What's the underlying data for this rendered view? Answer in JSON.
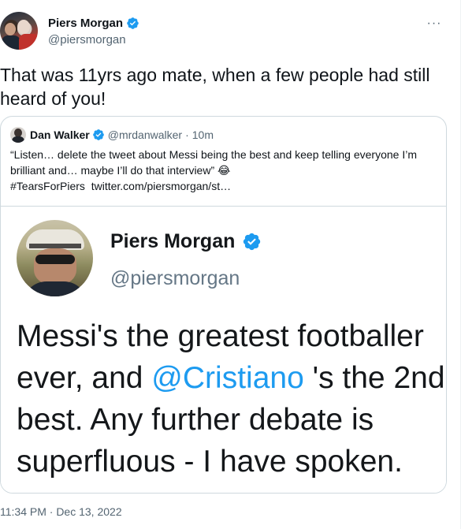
{
  "tweet": {
    "author_name": "Piers Morgan",
    "author_handle": "@piersmorgan",
    "more_label": "···",
    "text": "That was 11yrs ago mate, when a few people had still heard of you!",
    "timestamp": "11:34 PM · Dec 13, 2022"
  },
  "quote": {
    "author_name": "Dan Walker",
    "author_handle": "@mrdanwalker",
    "separator": "·",
    "time": "10m",
    "text": "“Listen… delete the tweet about Messi being the best and keep telling everyone I’m brilliant and… maybe I’ll do that interview” 😂",
    "hashtag": "#TearsForPiers",
    "link": "twitter.com/piersmorgan/st…"
  },
  "media": {
    "author_name": "Piers Morgan",
    "author_handle": "@piersmorgan",
    "text_part1": "Messi's the greatest footballer ever, and ",
    "mention": "@Cristiano",
    "text_part2": " 's the 2nd best. Any further debate is superfluous - I have spoken."
  },
  "colors": {
    "accent": "#1d9bf0",
    "text_primary": "#0f1419",
    "text_secondary": "#536471",
    "border": "#cfd9de"
  },
  "icons": {
    "verified": "verified-badge-icon",
    "more": "more-dots-icon"
  }
}
